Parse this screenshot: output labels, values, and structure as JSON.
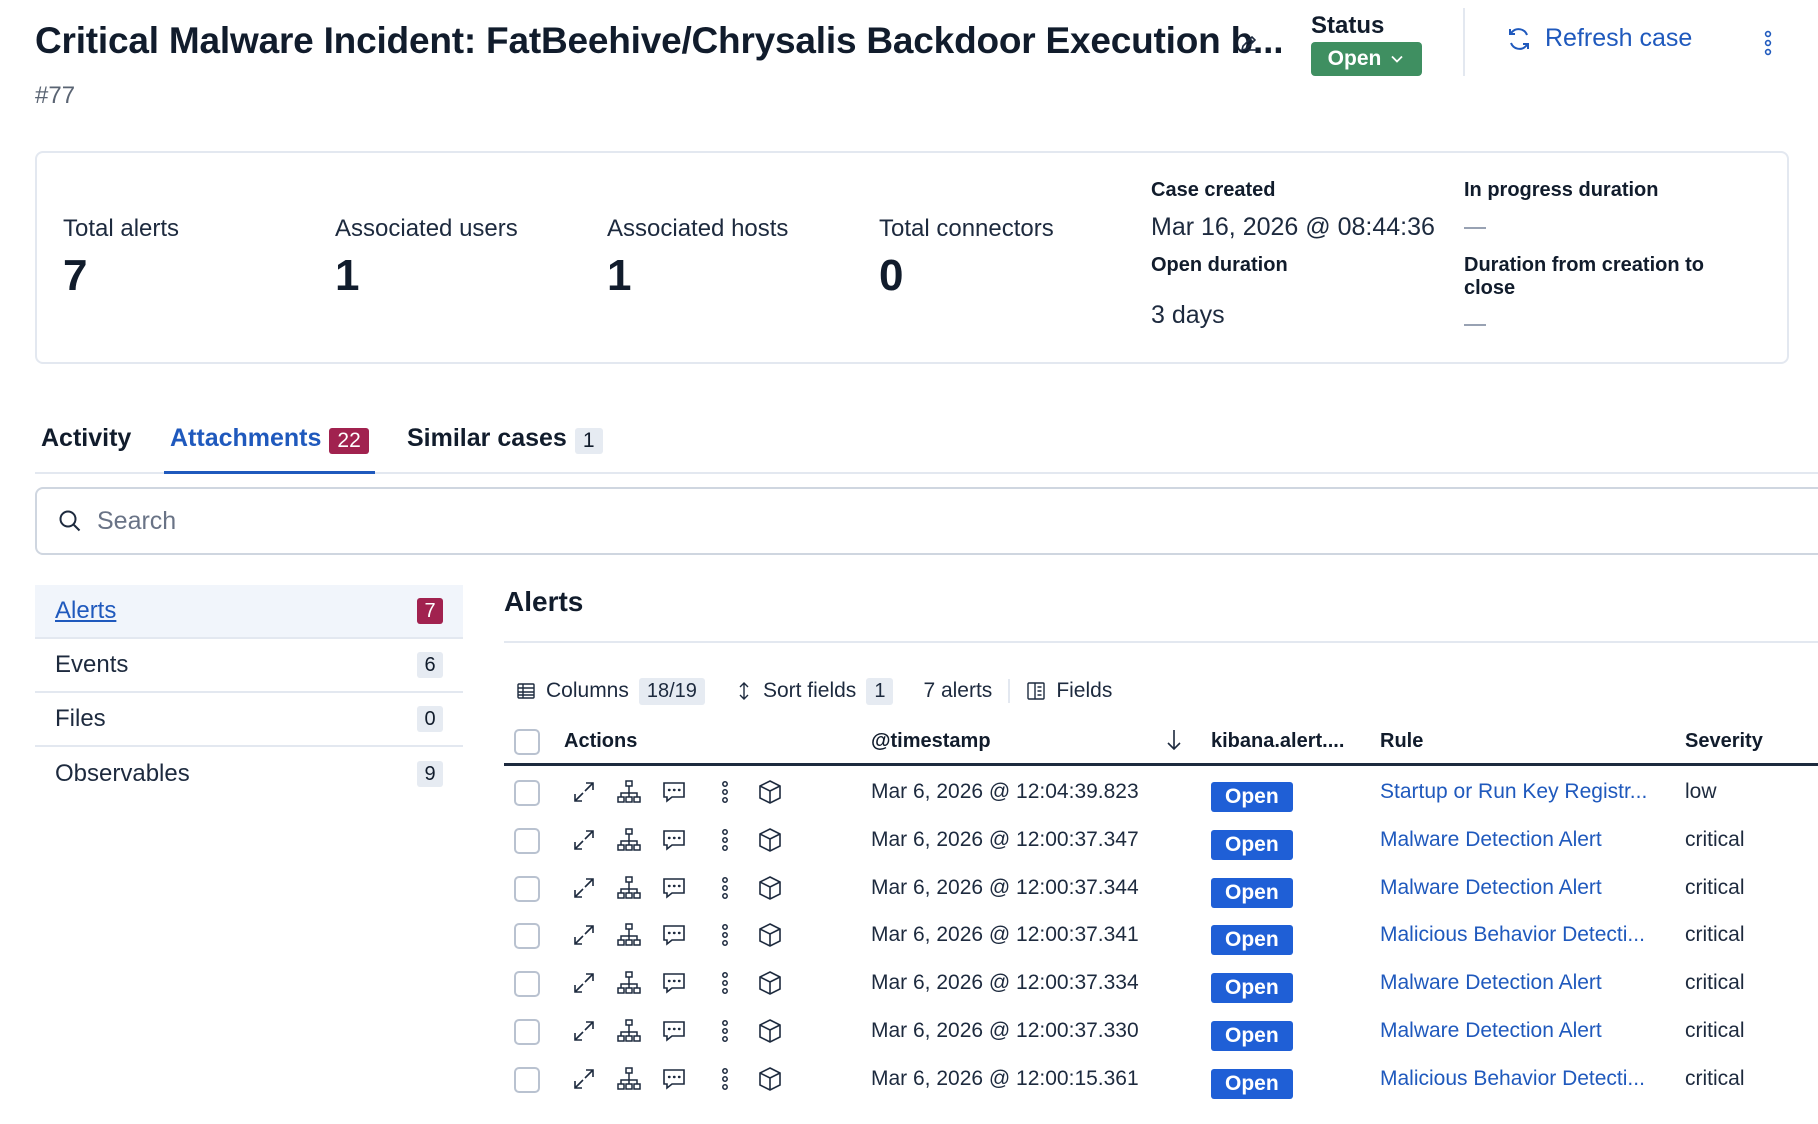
{
  "header": {
    "title": "Critical Malware Incident: FatBeehive/Chrysalis Backdoor Execution b...",
    "case_number": "#77",
    "status_label": "Status",
    "status_value": "Open",
    "refresh_label": "Refresh case"
  },
  "summary": {
    "stats": [
      {
        "label": "Total alerts",
        "value": "7"
      },
      {
        "label": "Associated users",
        "value": "1"
      },
      {
        "label": "Associated hosts",
        "value": "1"
      },
      {
        "label": "Total connectors",
        "value": "0"
      }
    ],
    "case_created_label": "Case created",
    "case_created_value": "Mar 16, 2026 @ 08:44:36",
    "open_duration_label": "Open duration",
    "open_duration_value": "3 days",
    "in_progress_label": "In progress duration",
    "duration_close_label_1": "Duration from creation to",
    "duration_close_label_2": "close"
  },
  "tabs": [
    {
      "label": "Activity",
      "count": ""
    },
    {
      "label": "Attachments",
      "count": "22"
    },
    {
      "label": "Similar cases",
      "count": "1"
    }
  ],
  "search": {
    "placeholder": "Search"
  },
  "leftnav": [
    {
      "label": "Alerts",
      "count": "7"
    },
    {
      "label": "Events",
      "count": "6"
    },
    {
      "label": "Files",
      "count": "0"
    },
    {
      "label": "Observables",
      "count": "9"
    }
  ],
  "alerts": {
    "title": "Alerts",
    "toolbar": {
      "columns_label": "Columns",
      "columns_count": "18/19",
      "sort_label": "Sort fields",
      "sort_count": "1",
      "alerts_count": "7 alerts",
      "fields_label": "Fields"
    },
    "headers": {
      "actions": "Actions",
      "timestamp": "@timestamp",
      "status": "kibana.alert....",
      "rule": "Rule",
      "severity": "Severity"
    },
    "rows": [
      {
        "timestamp": "Mar 6, 2026 @ 12:04:39.823",
        "status": "Open",
        "rule": "Startup or Run Key Registr...",
        "severity": "low"
      },
      {
        "timestamp": "Mar 6, 2026 @ 12:00:37.347",
        "status": "Open",
        "rule": "Malware Detection Alert",
        "severity": "critical"
      },
      {
        "timestamp": "Mar 6, 2026 @ 12:00:37.344",
        "status": "Open",
        "rule": "Malware Detection Alert",
        "severity": "critical"
      },
      {
        "timestamp": "Mar 6, 2026 @ 12:00:37.341",
        "status": "Open",
        "rule": "Malicious Behavior Detecti...",
        "severity": "critical"
      },
      {
        "timestamp": "Mar 6, 2026 @ 12:00:37.334",
        "status": "Open",
        "rule": "Malware Detection Alert",
        "severity": "critical"
      },
      {
        "timestamp": "Mar 6, 2026 @ 12:00:37.330",
        "status": "Open",
        "rule": "Malware Detection Alert",
        "severity": "critical"
      },
      {
        "timestamp": "Mar 6, 2026 @ 12:00:15.361",
        "status": "Open",
        "rule": "Malicious Behavior Detecti...",
        "severity": "critical"
      }
    ]
  },
  "colors": {
    "accent_link": "#1f59bd",
    "status_green": "#3f8f61",
    "badge_accent": "#a1224f",
    "open_pill": "#1f5fd6"
  }
}
